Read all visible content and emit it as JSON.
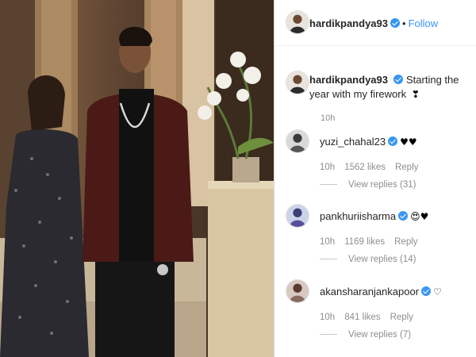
{
  "post": {
    "username": "hardikpandya93",
    "follow_label": "Follow",
    "separator": "•"
  },
  "caption": {
    "username": "hardikpandya93",
    "text": "Starting the year with my firework",
    "emoji": "❣",
    "time": "10h"
  },
  "comments": [
    {
      "username": "yuzi_chahal23",
      "verified": true,
      "emoji": "♥♥",
      "time": "10h",
      "likes": "1562 likes",
      "reply": "Reply",
      "view_replies": "View replies (31)"
    },
    {
      "username": "pankhuriisharma",
      "verified": true,
      "emoji": "😍♥",
      "time": "10h",
      "likes": "1169 likes",
      "reply": "Reply",
      "view_replies": "View replies (14)"
    },
    {
      "username": "akansharanjankapoor",
      "verified": true,
      "emoji": "♡",
      "time": "10h",
      "likes": "841 likes",
      "reply": "Reply",
      "view_replies": "View replies (7)"
    }
  ],
  "colors": {
    "link": "#3897f0",
    "text": "#262626",
    "muted": "#8e8e8e",
    "verified": "#3897f0"
  }
}
